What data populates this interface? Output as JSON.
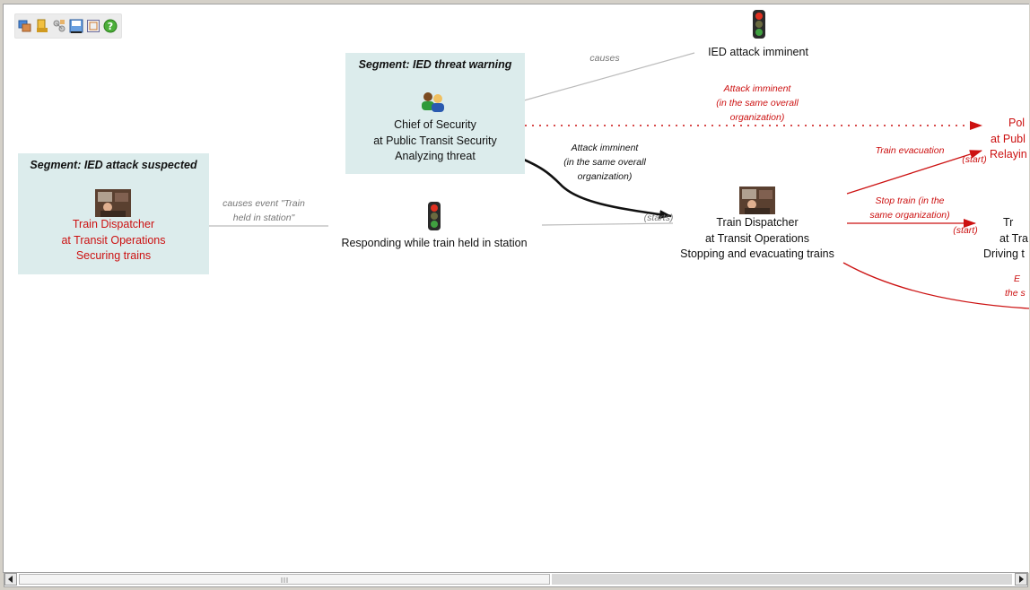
{
  "toolbar": {
    "buttons": [
      "windows-icon",
      "hand-icon",
      "network-icon",
      "save-icon",
      "fit-view-icon",
      "help-icon"
    ]
  },
  "segments": {
    "threat_warning": {
      "title": "Segment: IED threat warning",
      "role_line1": "Chief of Security",
      "role_line2": "at Public Transit Security",
      "role_line3": "Analyzing threat"
    },
    "attack_suspected": {
      "title": "Segment: IED attack suspected",
      "role_line1": "Train Dispatcher",
      "role_line2": "at Transit Operations",
      "role_line3": "Securing trains"
    }
  },
  "events": {
    "ied_imminent": "IED attack imminent",
    "responding": "Responding while train held in station"
  },
  "nodes": {
    "dispatcher_stopping": {
      "line1": "Train Dispatcher",
      "line2": "at Transit Operations",
      "line3": "Stopping and evacuating trains"
    },
    "police_partial": {
      "line1": "Pol",
      "line2": "at Publ",
      "line3": "Relayin"
    },
    "driver_partial": {
      "line1": "Tr",
      "line2": "at Tra",
      "line3": "Driving t"
    }
  },
  "edges": {
    "causes": "causes",
    "causes_event_1": "causes event \"Train",
    "causes_event_2": "held in station\"",
    "attack_imminent_red_1": "Attack imminent",
    "attack_imminent_red_2": "(in the same overall",
    "attack_imminent_red_3": "organization)",
    "attack_imminent_black_1": "Attack imminent",
    "attack_imminent_black_2": "(in the same overall",
    "attack_imminent_black_3": "organization)",
    "starts": "(starts)",
    "train_evacuation": "Train evacuation",
    "start_1": "(start)",
    "stop_train_1": "Stop train (in the",
    "stop_train_2": "same organization)",
    "start_2": "(start)",
    "partial_e": "E",
    "partial_the_s": "the s"
  },
  "colors": {
    "segment_bg": "#dcecec",
    "red": "#cc1111",
    "grey_edge": "#bbbbbb"
  }
}
